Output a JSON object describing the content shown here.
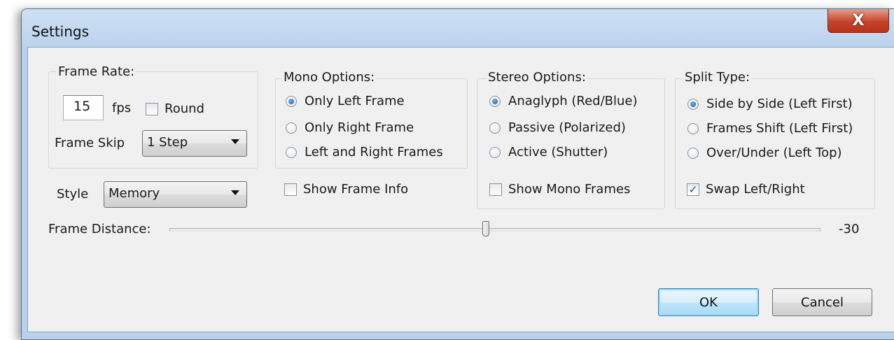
{
  "window": {
    "title": "Settings",
    "close_glyph": "X"
  },
  "frame_rate": {
    "label": "Frame Rate:",
    "value": "15",
    "unit": "fps",
    "round_label": "Round",
    "round_checked": false,
    "frame_skip_label": "Frame Skip",
    "frame_skip_value": "1 Step"
  },
  "style": {
    "label": "Style",
    "value": "Memory"
  },
  "mono_options": {
    "label": "Mono Options:",
    "options": [
      "Only Left Frame",
      "Only Right Frame",
      "Left and Right Frames"
    ],
    "selected_index": 0,
    "show_frame_info_label": "Show Frame Info",
    "show_frame_info_checked": false
  },
  "stereo_options": {
    "label": "Stereo Options:",
    "options": [
      "Anaglyph (Red/Blue)",
      "Passive (Polarized)",
      "Active (Shutter)"
    ],
    "selected_index": 0,
    "show_mono_frames_label": "Show Mono Frames",
    "show_mono_frames_checked": false
  },
  "split_type": {
    "label": "Split Type:",
    "options": [
      "Side by Side (Left First)",
      "Frames Shift (Left First)",
      "Over/Under (Left Top)"
    ],
    "selected_index": 0,
    "swap_label": "Swap Left/Right",
    "swap_checked": true
  },
  "frame_distance": {
    "label": "Frame Distance:",
    "value_text": "-30",
    "slider_fraction": 0.486
  },
  "buttons": {
    "ok": "OK",
    "cancel": "Cancel"
  },
  "colors": {
    "titlebar": "#b9d1ec",
    "close_button": "#c7432a",
    "dialog_body": "#f0f0f0",
    "default_button": "#a7d9f5"
  },
  "icons": {
    "close": "close-icon",
    "dropdown": "chevron-down-icon",
    "check": "checkmark-icon"
  }
}
